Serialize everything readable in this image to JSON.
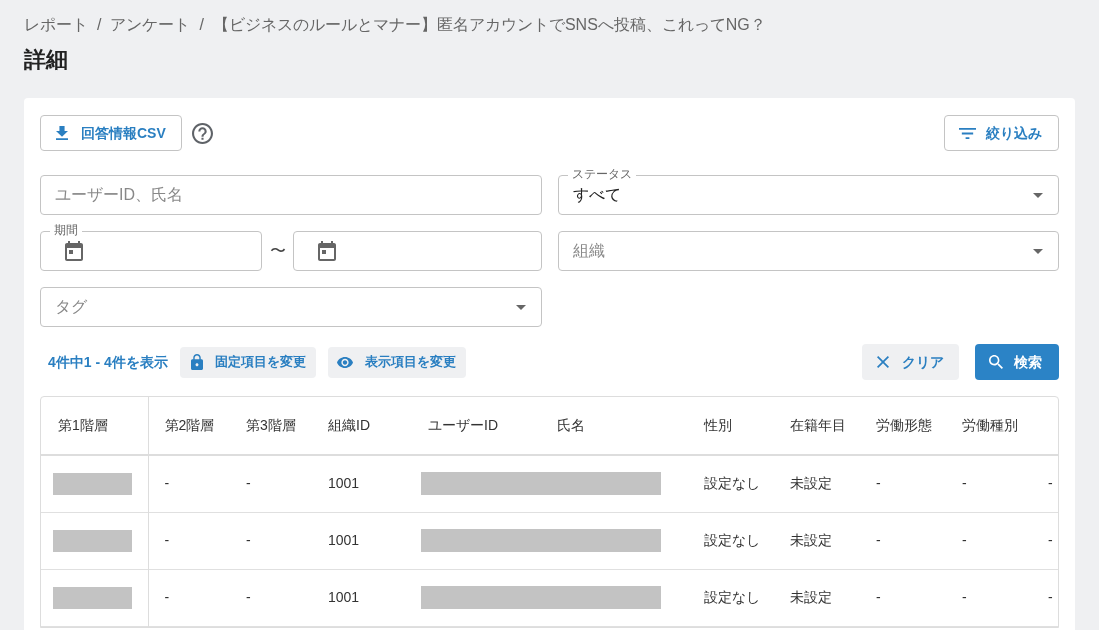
{
  "breadcrumb": [
    {
      "label": "レポート",
      "separator": "/"
    },
    {
      "label": "アンケート",
      "separator": "/"
    },
    {
      "label": "【ビジネスのルールとマナー】匿名アカウントでSNSへ投稿、これってNG？"
    }
  ],
  "title": "詳細",
  "toolbar": {
    "csv_button": "回答情報CSV",
    "filter_button": "絞り込み"
  },
  "filters": {
    "search": {
      "placeholder": "ユーザーID、氏名"
    },
    "status": {
      "label": "ステータス",
      "value": "すべて"
    },
    "period": {
      "label": "期間",
      "separator": "〜"
    },
    "organization": {
      "placeholder": "組織"
    },
    "tag": {
      "placeholder": "タグ"
    }
  },
  "results": {
    "summary": "4件中1 - 4件を表示",
    "fixed_columns_button": "固定項目を変更",
    "visible_columns_button": "表示項目を変更",
    "clear_button": "クリア",
    "search_button": "検索"
  },
  "table": {
    "columns": [
      {
        "label": "第1階層"
      },
      {
        "label": "第2階層"
      },
      {
        "label": "第3階層"
      },
      {
        "label": "組織ID"
      },
      {
        "label": "ユーザーID"
      },
      {
        "label": "氏名"
      },
      {
        "label": "性別"
      },
      {
        "label": "在籍年目"
      },
      {
        "label": "労働形態"
      },
      {
        "label": "労働種別"
      },
      {}
    ],
    "rows": [
      {
        "cells": [
          {
            "kind": "redacted"
          },
          {
            "kind": "text",
            "text": "-"
          },
          {
            "kind": "text",
            "text": "-"
          },
          {
            "kind": "text",
            "text": "1001"
          },
          {
            "kind": "redacted_wide",
            "colspan": 2
          },
          {
            "kind": "text",
            "text": "設定なし"
          },
          {
            "kind": "text",
            "text": "未設定"
          },
          {
            "kind": "text",
            "text": "-"
          },
          {
            "kind": "text",
            "text": "-"
          },
          {
            "kind": "text",
            "text": "-"
          }
        ]
      },
      {
        "cells": [
          {
            "kind": "redacted"
          },
          {
            "kind": "text",
            "text": "-"
          },
          {
            "kind": "text",
            "text": "-"
          },
          {
            "kind": "text",
            "text": "1001"
          },
          {
            "kind": "redacted_wide",
            "colspan": 2
          },
          {
            "kind": "text",
            "text": "設定なし"
          },
          {
            "kind": "text",
            "text": "未設定"
          },
          {
            "kind": "text",
            "text": "-"
          },
          {
            "kind": "text",
            "text": "-"
          },
          {
            "kind": "text",
            "text": "-"
          }
        ]
      },
      {
        "cells": [
          {
            "kind": "redacted"
          },
          {
            "kind": "text",
            "text": "-"
          },
          {
            "kind": "text",
            "text": "-"
          },
          {
            "kind": "text",
            "text": "1001"
          },
          {
            "kind": "redacted_wide",
            "colspan": 2
          },
          {
            "kind": "text",
            "text": "設定なし"
          },
          {
            "kind": "text",
            "text": "未設定"
          },
          {
            "kind": "text",
            "text": "-"
          },
          {
            "kind": "text",
            "text": "-"
          },
          {
            "kind": "text",
            "text": "-"
          }
        ]
      }
    ]
  }
}
